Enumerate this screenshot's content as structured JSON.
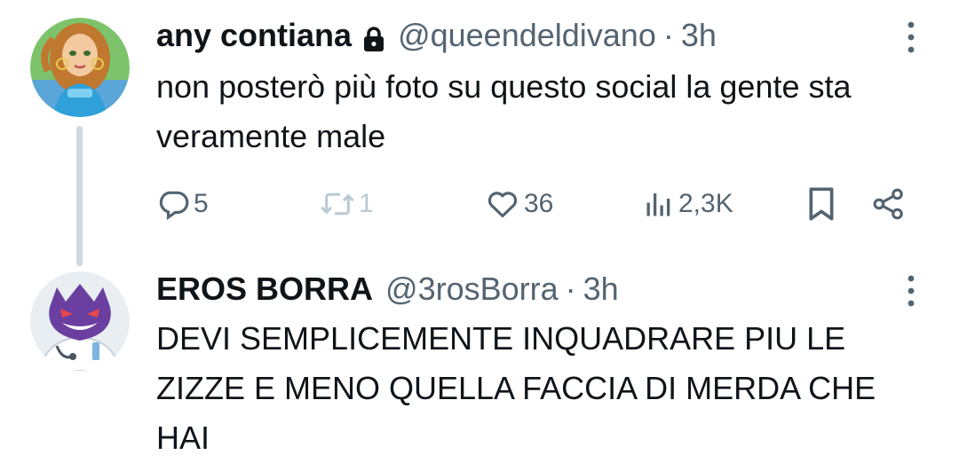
{
  "thread": {
    "original": {
      "author_name": "any contiana",
      "handle": "@queendeldivano",
      "separator": "·",
      "time": "3h",
      "text": "non posterò più foto su questo social la gente sta veramente male",
      "locked": true,
      "avatar_icon": "cartoon-fairy-avatar",
      "actions": {
        "reply_count": "5",
        "retweet_count": "1",
        "like_count": "36",
        "views_count": "2,3K"
      }
    },
    "reply": {
      "author_name": "EROS BORRA",
      "handle": "@3rosBorra",
      "separator": "·",
      "time": "3h",
      "text": "DEVI SEMPLICEMENTE INQUADRARE PIU LE ZIZZE E MENO QUELLA FACCIA DI MERDA CHE HAI",
      "avatar_icon": "purple-ghost-doctor-avatar"
    }
  },
  "colors": {
    "text_primary": "#0f1419",
    "text_secondary": "#536471",
    "retweet_muted": "#b9cad3",
    "thread_line": "#cfd9de"
  }
}
